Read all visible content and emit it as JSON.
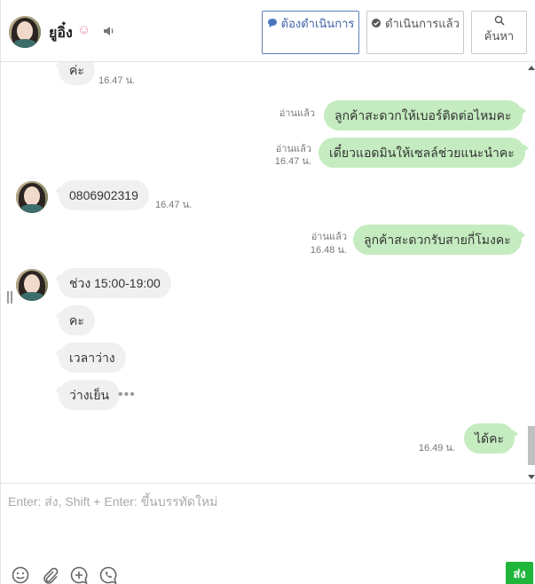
{
  "header": {
    "contact_name": "ยูอิ๋ง",
    "name_emoji_icon": "smiling-face-with-hearts-icon",
    "sound_icon": "speaker-icon",
    "buttons": [
      {
        "label": "ต้องดำเนินการ",
        "icon": "speech-bubble-icon",
        "active": true
      },
      {
        "label": "ดำเนินการแล้ว",
        "icon": "check-circle-icon",
        "active": false
      },
      {
        "label": "ค้นหา",
        "icon": "search-icon",
        "active": false
      }
    ]
  },
  "messages": [
    {
      "direction": "in",
      "text": "ค่ะ",
      "time": "16.47 น.",
      "avatar": false
    },
    {
      "direction": "out",
      "text": "ลูกค้าสะดวกให้เบอร์ติดต่อไหมคะ",
      "read": "อ่านแล้ว",
      "time": ""
    },
    {
      "direction": "out",
      "text": "เดี๋ยวแอดมินให้เซลล์ช่วยแนะนำคะ",
      "read": "อ่านแล้ว",
      "time": "16.47 น."
    },
    {
      "direction": "in",
      "text": "0806902319",
      "time": "16.47 น.",
      "avatar": true
    },
    {
      "direction": "out",
      "text": "ลูกค้าสะดวกรับสายกี่โมงคะ",
      "read": "อ่านแล้ว",
      "time": "16.48 น."
    },
    {
      "direction": "in",
      "text": "ช่วง 15:00-19:00",
      "time": "",
      "avatar": true
    },
    {
      "direction": "in",
      "text": "คะ",
      "time": "",
      "avatar": false
    },
    {
      "direction": "in",
      "text": "เวลาว่าง",
      "time": "",
      "avatar": false
    },
    {
      "direction": "in",
      "text": "ว่างเย็น",
      "time": "",
      "avatar": false
    },
    {
      "direction": "out",
      "text": "ได้คะ",
      "read": "",
      "time": "16.49 น."
    }
  ],
  "composer": {
    "placeholder": "Enter: ส่ง, Shift + Enter: ขึ้นบรรทัดใหม่",
    "value": "",
    "tools": [
      "emoji-icon",
      "paperclip-icon",
      "add-chat-icon",
      "phone-icon"
    ],
    "send_label": "ส่ง"
  },
  "colors": {
    "outgoing_bubble": "#c5ecc0",
    "incoming_bubble": "#f0f0f0",
    "send_button": "#1fb53a",
    "primary_outline": "#5b7fb8"
  }
}
